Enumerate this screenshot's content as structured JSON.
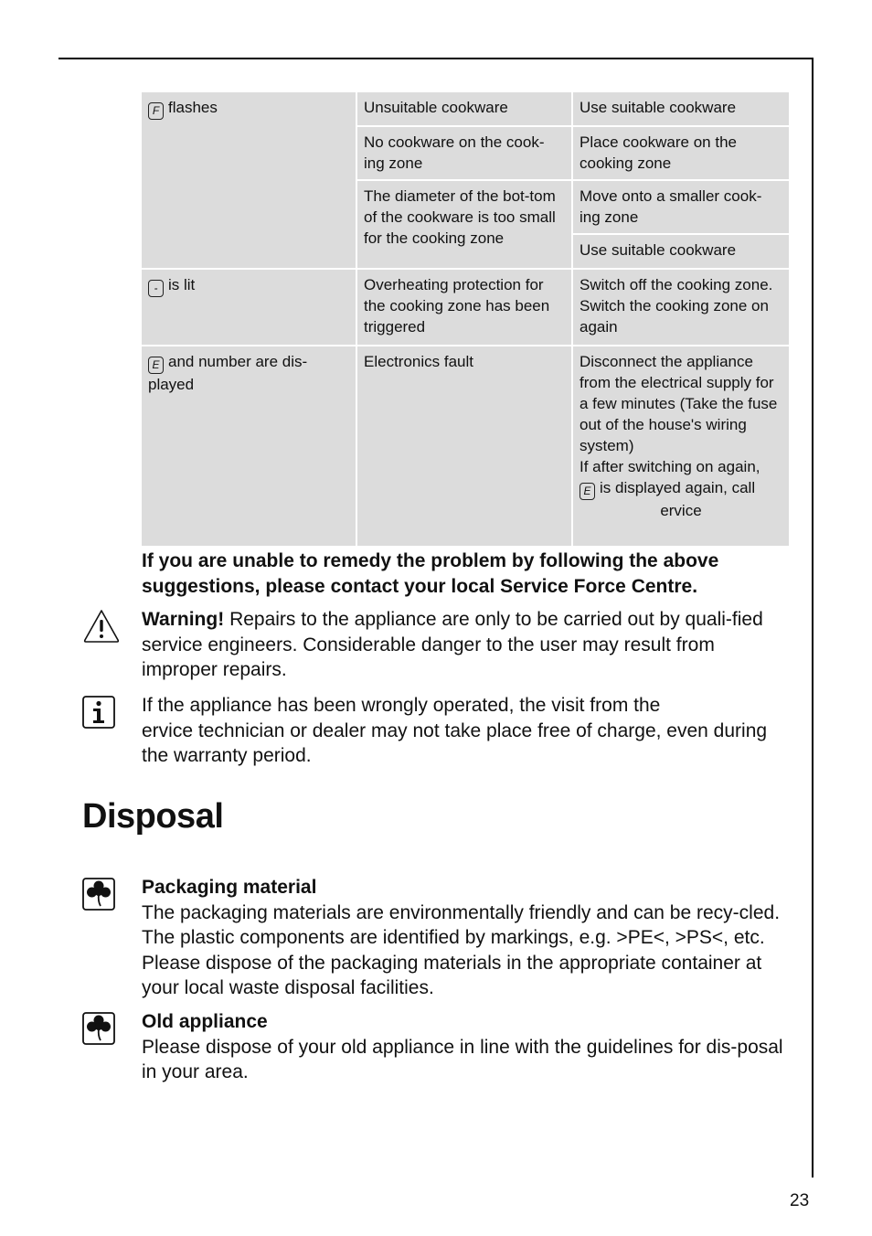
{
  "troubleshooting_table": {
    "rows": [
      {
        "indicator_symbol": "F",
        "indicator_text": "flashes",
        "causes": [
          {
            "cause": "Unsuitable cookware",
            "remedies": [
              "Use suitable cookware"
            ]
          },
          {
            "cause": "No cookware on the cook-ing zone",
            "remedies": [
              "Place cookware on the cooking zone"
            ]
          },
          {
            "cause": "The diameter of the bot-tom of the cookware is too small for the cooking zone",
            "remedies": [
              "Move onto a smaller cook-ing zone",
              "Use suitable cookware"
            ]
          }
        ]
      },
      {
        "indicator_symbol": "-",
        "indicator_text": "is lit",
        "causes": [
          {
            "cause": "Overheating protection for the cooking zone has been triggered",
            "remedies": [
              "Switch off the cooking zone. Switch the cooking zone on again"
            ]
          }
        ]
      },
      {
        "indicator_symbol": "E",
        "indicator_text": "and number are dis-played",
        "causes": [
          {
            "cause": "Electronics fault",
            "remedy_part1": "Disconnect the appliance from the electrical supply for a few minutes (Take the fuse out of the house's wiring system)",
            "remedy_part2": "If after switching on again,",
            "remedy_symbol": "E",
            "remedy_part3": "is displayed again, call",
            "remedy_part4": "ervice"
          }
        ]
      }
    ]
  },
  "contact_notice": "If you are unable to remedy the problem by following the above suggestions, please contact your local Service Force Centre.",
  "warning": {
    "icon": "warning-triangle-icon",
    "label": "Warning!",
    "text": "Repairs to the appliance are only to be carried out by quali-fied service engineers. Considerable danger to the user may result from improper repairs."
  },
  "info": {
    "icon": "info-icon",
    "text_line1": "If the appliance has been wrongly operated, the visit from the",
    "text_rest": "ervice technician or dealer may not take place free of charge, even during the warranty period."
  },
  "disposal": {
    "heading": "Disposal",
    "items": [
      {
        "icon": "recycling-clover-icon",
        "title": "Packaging material",
        "text": "The packaging materials are environmentally friendly and can be recy-cled. The plastic components are identified by markings, e.g. >PE<, >PS<, etc. Please dispose of the packaging materials in the appropriate container at your local waste disposal facilities."
      },
      {
        "icon": "recycling-clover-icon",
        "title": "Old appliance",
        "text": "Please dispose of your old appliance in line with the guidelines for dis-posal in your area."
      }
    ]
  },
  "page_number": "23"
}
